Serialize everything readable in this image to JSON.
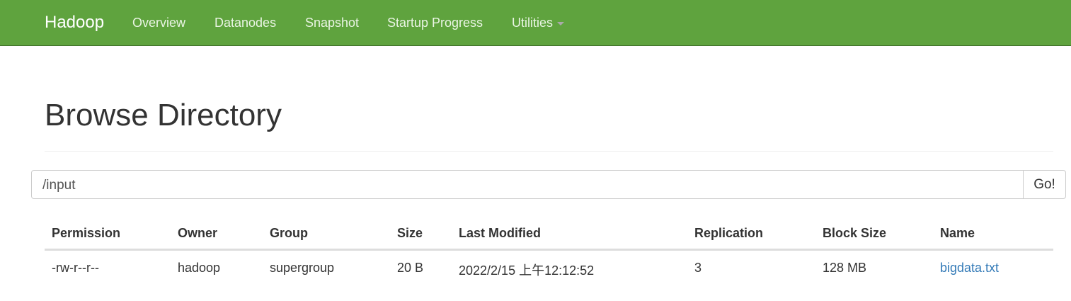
{
  "nav": {
    "brand": "Hadoop",
    "items": [
      "Overview",
      "Datanodes",
      "Snapshot",
      "Startup Progress",
      "Utilities"
    ]
  },
  "page_title": "Browse Directory",
  "path_input": {
    "value": "/input"
  },
  "go_button": "Go!",
  "table": {
    "headers": [
      "Permission",
      "Owner",
      "Group",
      "Size",
      "Last Modified",
      "Replication",
      "Block Size",
      "Name"
    ],
    "rows": [
      [
        "-rw-r--r--",
        "hadoop",
        "supergroup",
        "20 B",
        "2022/2/15 上午12:12:52",
        "3",
        "128 MB",
        "bigdata.txt"
      ]
    ]
  }
}
